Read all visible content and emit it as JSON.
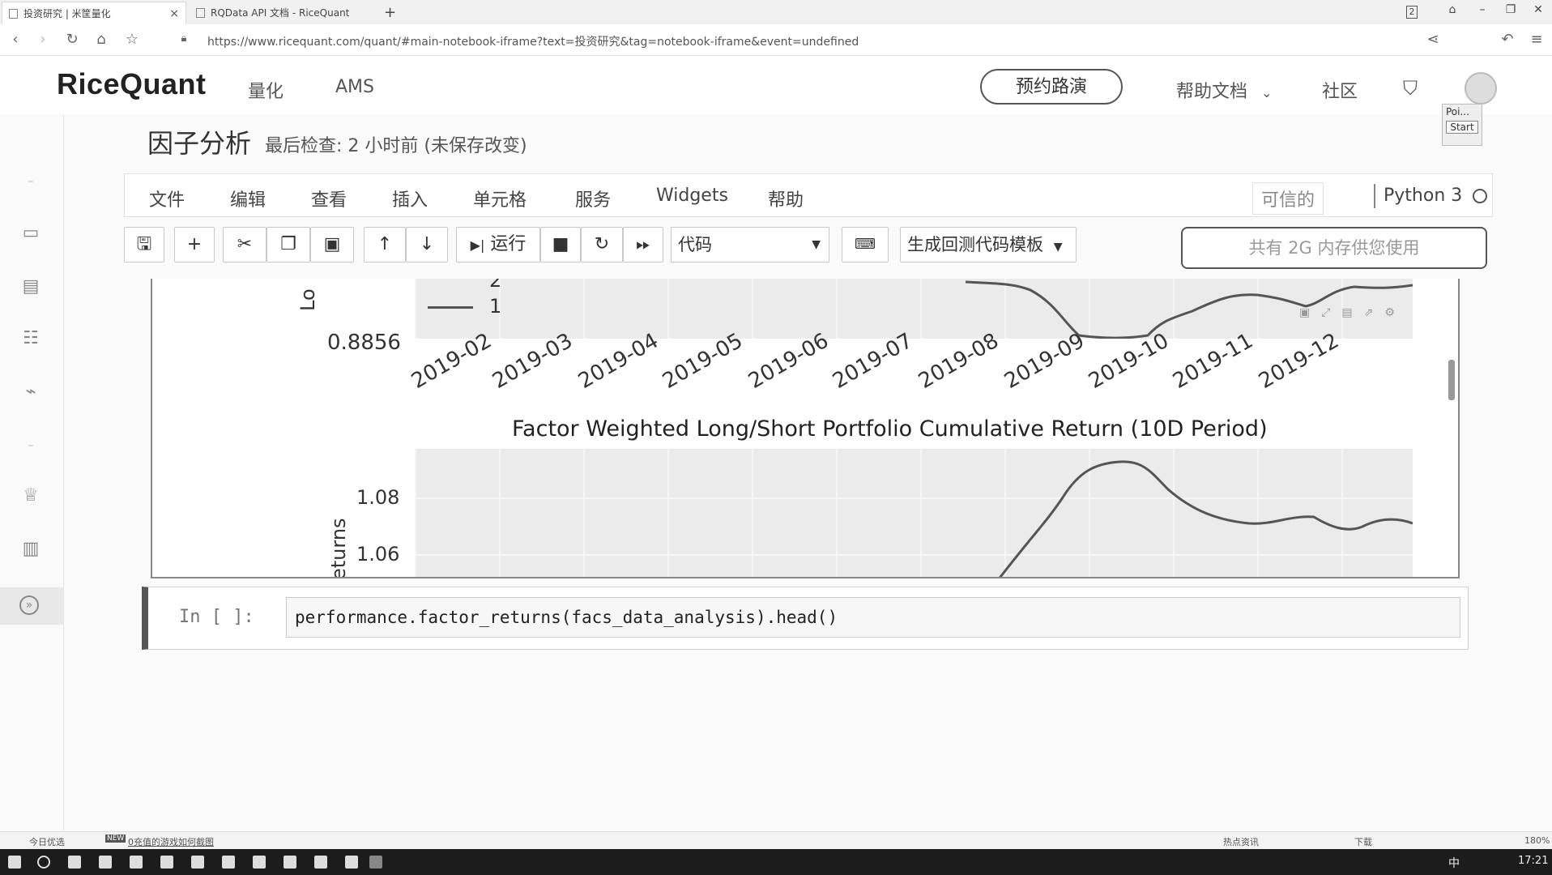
{
  "browser": {
    "tabs": [
      {
        "label": "投资研究 | 米筐量化"
      },
      {
        "label": "RQData API 文档 - RiceQuant"
      }
    ],
    "new_tab": "+",
    "window_badge": "2",
    "url": "https://www.ricequant.com/quant/#main-notebook-iframe?text=投资研究&tag=notebook-iframe&event=undefined"
  },
  "header": {
    "logo": "RiceQuant",
    "nav": [
      "量化",
      "AMS"
    ],
    "demo_button": "预约路演",
    "help_docs": "帮助文档",
    "community": "社区",
    "popup_label": "Poi...",
    "popup_button": "Start"
  },
  "notebook": {
    "title": "因子分析",
    "checkpoint": "最后检查: 2 小时前  (未保存改变)",
    "menus": [
      "文件",
      "编辑",
      "查看",
      "插入",
      "单元格",
      "服务",
      "Widgets",
      "帮助"
    ],
    "trusted": "可信的",
    "kernel": "Python 3",
    "run_label": "运行",
    "cell_type": "代码",
    "template_button": "生成回测代码模板",
    "memory_info": "共有 2G 内存供您使用"
  },
  "chart_data": [
    {
      "type": "line",
      "title": "",
      "ylabel": "Lo",
      "legend": [
        "2",
        "1"
      ],
      "yticks": [
        "0.8856"
      ],
      "x": [
        "2019-02",
        "2019-03",
        "2019-04",
        "2019-05",
        "2019-06",
        "2019-07",
        "2019-08",
        "2019-09",
        "2019-10",
        "2019-11",
        "2019-12"
      ],
      "series": [
        {
          "name": "1",
          "values": [
            null,
            null,
            null,
            null,
            null,
            null,
            0.93,
            0.905,
            0.886,
            0.9,
            0.91
          ]
        }
      ]
    },
    {
      "type": "line",
      "title": "Factor Weighted Long/Short Portfolio Cumulative Return (10D Period)",
      "ylabel": "eturns",
      "yticks": [
        "1.08",
        "1.06"
      ],
      "x": [
        "2019-07",
        "2019-08",
        "2019-09",
        "2019-10",
        "2019-11",
        "2019-12"
      ],
      "series": [
        {
          "values": [
            1.05,
            1.075,
            1.092,
            1.08,
            1.074,
            1.077
          ]
        }
      ]
    }
  ],
  "input_cell": {
    "prompt": "In  [  ]:",
    "code": "performance.factor_returns(facs_data_analysis).head()"
  },
  "statusbar": {
    "left": "今日优选",
    "news": "0充值的游戏如何截图",
    "hot": "热点资讯",
    "download": "下载",
    "zoom": "180%"
  },
  "taskbar": {
    "ime": "中",
    "clock": "17:21"
  }
}
